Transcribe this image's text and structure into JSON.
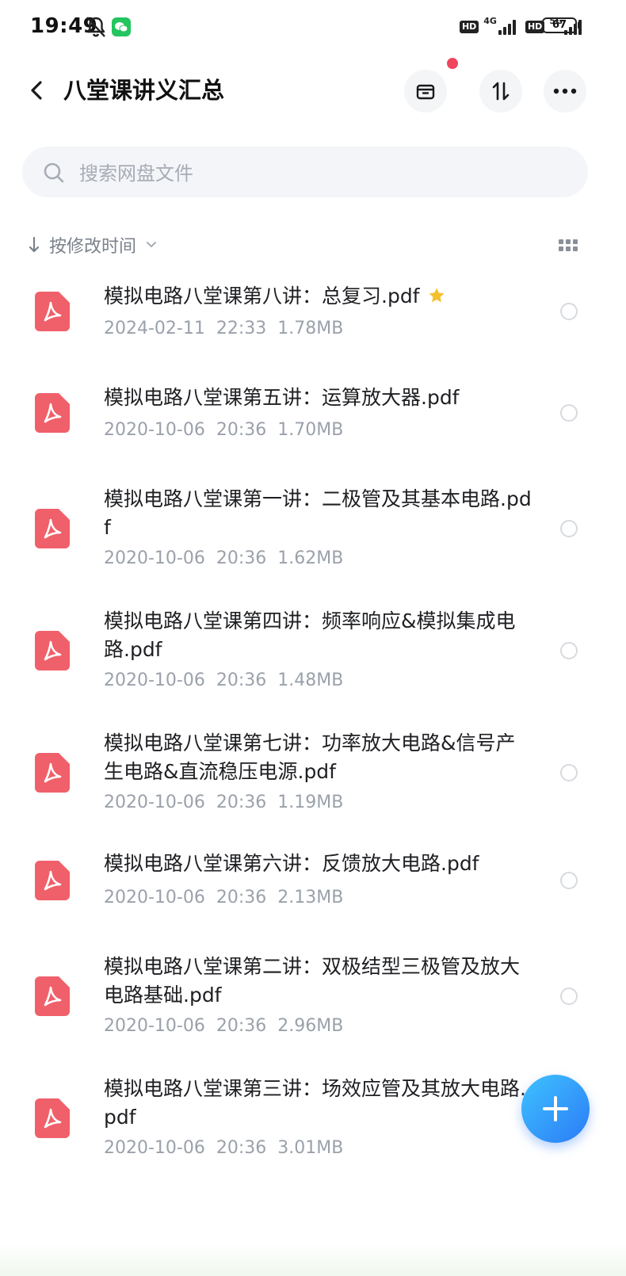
{
  "status_bar": {
    "time": "19:49",
    "hd_label": "HD",
    "network_1": "4G",
    "network_2": "5G",
    "battery": "67"
  },
  "header": {
    "title": "八堂课讲义汇总"
  },
  "search": {
    "placeholder": "搜索网盘文件"
  },
  "sort": {
    "label": "按修改时间"
  },
  "files": [
    {
      "name": "模拟电路八堂课第八讲：总复习.pdf",
      "date": "2024-02-11",
      "time": "22:33",
      "size": "1.78MB",
      "starred": true
    },
    {
      "name": "模拟电路八堂课第五讲：运算放大器.pdf",
      "date": "2020-10-06",
      "time": "20:36",
      "size": "1.70MB",
      "starred": false
    },
    {
      "name": "模拟电路八堂课第一讲：二极管及其基本电路.pdf",
      "date": "2020-10-06",
      "time": "20:36",
      "size": "1.62MB",
      "starred": false
    },
    {
      "name": "模拟电路八堂课第四讲：频率响应&模拟集成电路.pdf",
      "date": "2020-10-06",
      "time": "20:36",
      "size": "1.48MB",
      "starred": false
    },
    {
      "name": "模拟电路八堂课第七讲：功率放大电路&信号产生电路&直流稳压电源.pdf",
      "date": "2020-10-06",
      "time": "20:36",
      "size": "1.19MB",
      "starred": false
    },
    {
      "name": "模拟电路八堂课第六讲：反馈放大电路.pdf",
      "date": "2020-10-06",
      "time": "20:36",
      "size": "2.13MB",
      "starred": false
    },
    {
      "name": "模拟电路八堂课第二讲：双极结型三极管及放大电路基础.pdf",
      "date": "2020-10-06",
      "time": "20:36",
      "size": "2.96MB",
      "starred": false
    },
    {
      "name": "模拟电路八堂课第三讲：场效应管及其放大电路.pdf",
      "date": "2020-10-06",
      "time": "20:36",
      "size": "3.01MB",
      "starred": false
    }
  ],
  "colors": {
    "pdf_icon": "#f0606a",
    "star": "#f5c12b",
    "fab_start": "#3fc2ff",
    "fab_end": "#2b7bf6",
    "notification_dot": "#f0455e"
  },
  "icons": {
    "back": "chevron-left-icon",
    "archive": "archive-icon",
    "sort": "sort-arrows-icon",
    "more": "more-dots-icon",
    "search": "search-icon",
    "view": "grid-view-icon",
    "file": "pdf-icon",
    "star": "star-icon",
    "add": "plus-icon"
  }
}
